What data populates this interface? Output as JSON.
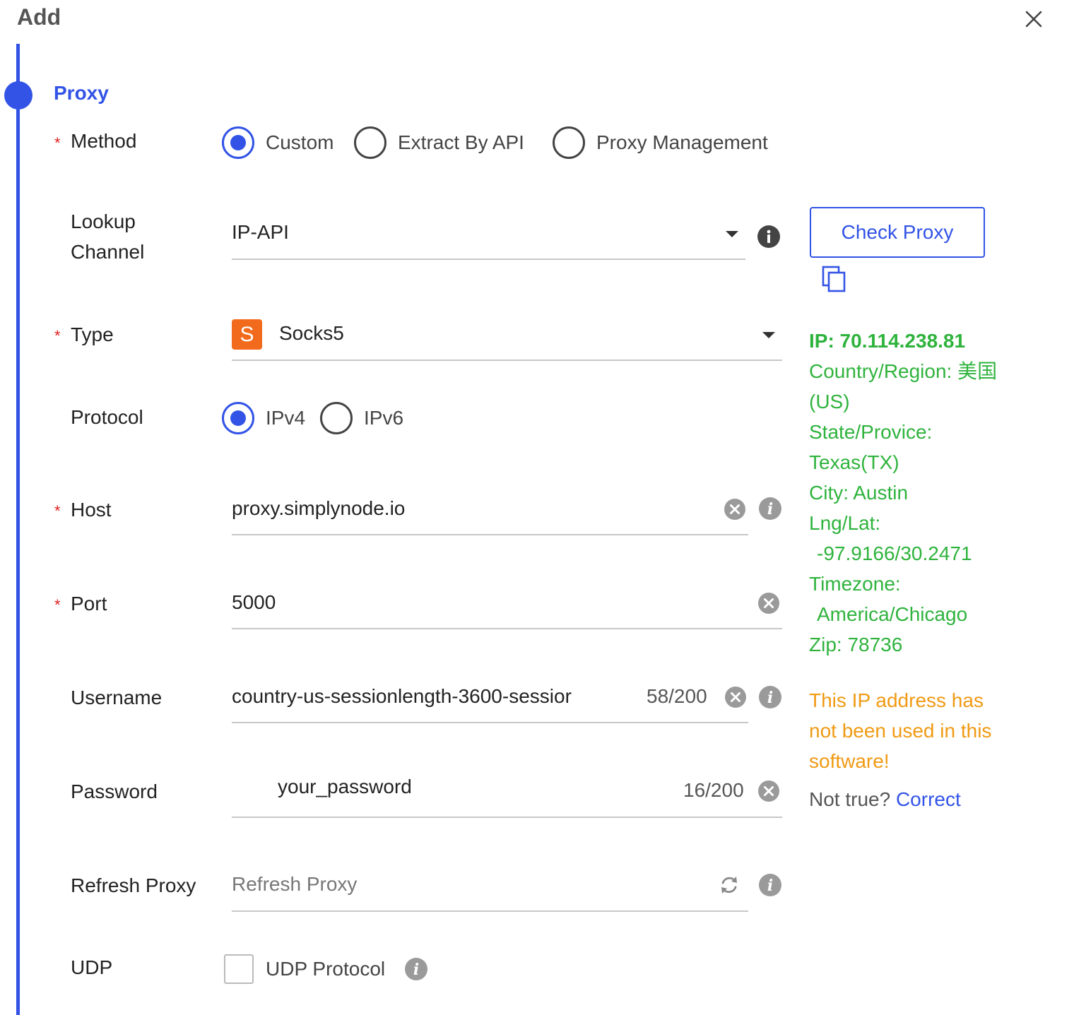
{
  "header": {
    "title": "Add"
  },
  "section": {
    "title": "Proxy"
  },
  "method": {
    "label": "Method",
    "options": [
      "Custom",
      "Extract By API",
      "Proxy Management"
    ],
    "selected": "Custom"
  },
  "lookup": {
    "label_line1": "Lookup",
    "label_line2": "Channel",
    "value": "IP-API"
  },
  "type": {
    "label": "Type",
    "badge": "S",
    "value": "Socks5"
  },
  "protocol": {
    "label": "Protocol",
    "options": [
      "IPv4",
      "IPv6"
    ],
    "selected": "IPv4"
  },
  "host": {
    "label": "Host",
    "value": "proxy.simplynode.io"
  },
  "port": {
    "label": "Port",
    "value": "5000"
  },
  "username": {
    "label": "Username",
    "value": "country-us-sessionlength-3600-sessior",
    "counter": "58/200"
  },
  "password": {
    "label": "Password",
    "value": "your_password",
    "counter": "16/200"
  },
  "refresh": {
    "label": "Refresh Proxy",
    "placeholder": "Refresh Proxy"
  },
  "udp": {
    "label": "UDP",
    "checkbox_label": "UDP Protocol",
    "checked": false
  },
  "check_button": {
    "label": "Check Proxy"
  },
  "ip_info": {
    "ip": "IP:  70.114.238.81",
    "country_label": "Country/Region:  美国",
    "country_code": "(US)",
    "state_label": "State/Provice:",
    "state_value": "Texas(TX)",
    "city": "City: Austin",
    "lnglat_label": "Lng/Lat:",
    "lnglat_value": "-97.9166/30.2471",
    "timezone_label": "Timezone:",
    "timezone_value": "America/Chicago",
    "zip": "Zip:  78736"
  },
  "warning": {
    "line1": "This IP address has",
    "line2": "not been used in this",
    "line3": "software!"
  },
  "not_true": {
    "text": "Not true?",
    "link": "Correct"
  },
  "colors": {
    "accent": "#3253e6",
    "success": "#2fb33d",
    "warning": "#f09a14",
    "required": "#e02020",
    "socks_badge": "#f26a1b"
  }
}
